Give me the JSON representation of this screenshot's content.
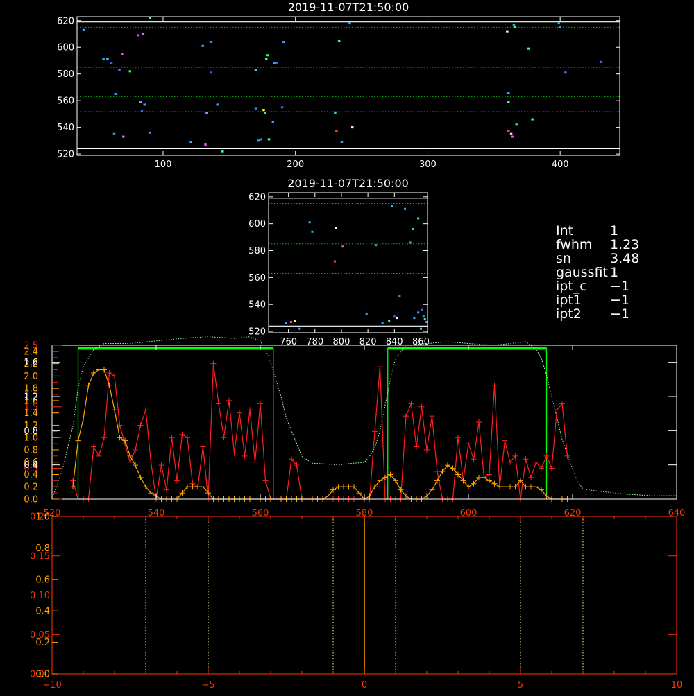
{
  "colors": {
    "background": "#000000",
    "frame": "#ffffff",
    "profile": "#ff2020",
    "fit": "#ffa500",
    "window_fill": "#00ff00",
    "ref_dotted": "#00c000",
    "red_dotted": "#c00000",
    "bottom_axis": "#ff3300",
    "bottom_marker": "#ffa500",
    "bottom_dotted": "#ffff80"
  },
  "params": {
    "rows": [
      {
        "key": "Int",
        "value": "1"
      },
      {
        "key": "fwhm",
        "value": "1.23"
      },
      {
        "key": "sn",
        "value": "3.48"
      },
      {
        "key": "gaussfit",
        "value": "1"
      },
      {
        "key": "ipt_c",
        "value": "−1"
      },
      {
        "key": "ipt1",
        "value": "−1"
      },
      {
        "key": "ipt2",
        "value": "−1"
      }
    ]
  },
  "chart_data": [
    {
      "id": "top",
      "type": "scatter",
      "title": "2019-11-07T21:50:00",
      "xlabel": "",
      "ylabel": "",
      "xlim": [
        35,
        445
      ],
      "ylim": [
        519,
        623
      ],
      "xticks": [
        100,
        200,
        300,
        400
      ],
      "yticks": [
        520,
        540,
        560,
        580,
        600,
        620
      ],
      "grid": false,
      "ref_lines_white": [
        619,
        524
      ],
      "ref_lines_green": [
        615,
        585,
        563
      ],
      "ref_lines_red": [
        552
      ],
      "points": [
        {
          "x": 40,
          "y": 613,
          "c": "#33aaff"
        },
        {
          "x": 55,
          "y": 591,
          "c": "#33aaff"
        },
        {
          "x": 58,
          "y": 591,
          "c": "#33ccff"
        },
        {
          "x": 61,
          "y": 588,
          "c": "#3366ff"
        },
        {
          "x": 63,
          "y": 535,
          "c": "#33aaff"
        },
        {
          "x": 64,
          "y": 565,
          "c": "#3399ff"
        },
        {
          "x": 67,
          "y": 583,
          "c": "#aa44ff"
        },
        {
          "x": 69,
          "y": 595,
          "c": "#ff44ff"
        },
        {
          "x": 70,
          "y": 533,
          "c": "#aa88ff"
        },
        {
          "x": 75,
          "y": 582,
          "c": "#33ff66"
        },
        {
          "x": 81,
          "y": 609,
          "c": "#ff44ff"
        },
        {
          "x": 83,
          "y": 559,
          "c": "#aa88ff"
        },
        {
          "x": 84,
          "y": 552,
          "c": "#3366ff"
        },
        {
          "x": 85,
          "y": 610,
          "c": "#aa88ff"
        },
        {
          "x": 86,
          "y": 557,
          "c": "#33aaff"
        },
        {
          "x": 90,
          "y": 536,
          "c": "#3399ff"
        },
        {
          "x": 90,
          "y": 622,
          "c": "#33ffaa"
        },
        {
          "x": 121,
          "y": 529,
          "c": "#33aaff"
        },
        {
          "x": 130,
          "y": 601,
          "c": "#33aaff"
        },
        {
          "x": 132,
          "y": 527,
          "c": "#ff44ff"
        },
        {
          "x": 133,
          "y": 551,
          "c": "#aa88ff"
        },
        {
          "x": 136,
          "y": 604,
          "c": "#3399ff"
        },
        {
          "x": 136,
          "y": 581,
          "c": "#3366ff"
        },
        {
          "x": 141,
          "y": 557,
          "c": "#33aaff"
        },
        {
          "x": 145,
          "y": 522,
          "c": "#33ffaa"
        },
        {
          "x": 170,
          "y": 583,
          "c": "#33ccff"
        },
        {
          "x": 170,
          "y": 554,
          "c": "#3366ff"
        },
        {
          "x": 172,
          "y": 530,
          "c": "#33aaff"
        },
        {
          "x": 174,
          "y": 531,
          "c": "#3399ff"
        },
        {
          "x": 176,
          "y": 553,
          "c": "#ffff33"
        },
        {
          "x": 177,
          "y": 551,
          "c": "#33ff66"
        },
        {
          "x": 178,
          "y": 591,
          "c": "#33ffaa"
        },
        {
          "x": 179,
          "y": 594,
          "c": "#33ff66"
        },
        {
          "x": 180,
          "y": 531,
          "c": "#33ffaa"
        },
        {
          "x": 183,
          "y": 544,
          "c": "#3399ff"
        },
        {
          "x": 184,
          "y": 588,
          "c": "#33aaff"
        },
        {
          "x": 186,
          "y": 588,
          "c": "#3366ff"
        },
        {
          "x": 190,
          "y": 555,
          "c": "#3366ff"
        },
        {
          "x": 191,
          "y": 604,
          "c": "#3399ff"
        },
        {
          "x": 230,
          "y": 551,
          "c": "#33ccff"
        },
        {
          "x": 231,
          "y": 537,
          "c": "#ff4444"
        },
        {
          "x": 233,
          "y": 605,
          "c": "#33ff66"
        },
        {
          "x": 235,
          "y": 529,
          "c": "#33aaff"
        },
        {
          "x": 241,
          "y": 618,
          "c": "#33aaff"
        },
        {
          "x": 243,
          "y": 540,
          "c": "#ffffff"
        },
        {
          "x": 360,
          "y": 612,
          "c": "#ffffff"
        },
        {
          "x": 361,
          "y": 559,
          "c": "#33ffaa"
        },
        {
          "x": 361,
          "y": 537,
          "c": "#ff4444"
        },
        {
          "x": 361,
          "y": 566,
          "c": "#33aaff"
        },
        {
          "x": 363,
          "y": 535,
          "c": "#ffffff"
        },
        {
          "x": 364,
          "y": 533,
          "c": "#ff44ff"
        },
        {
          "x": 365,
          "y": 617,
          "c": "#33aaff"
        },
        {
          "x": 366,
          "y": 615,
          "c": "#33ff66"
        },
        {
          "x": 367,
          "y": 542,
          "c": "#33ff66"
        },
        {
          "x": 376,
          "y": 599,
          "c": "#33ffaa"
        },
        {
          "x": 379,
          "y": 546,
          "c": "#33ffaa"
        },
        {
          "x": 399,
          "y": 618,
          "c": "#3399ff"
        },
        {
          "x": 400,
          "y": 615,
          "c": "#33aaff"
        },
        {
          "x": 404,
          "y": 581,
          "c": "#aa44ff"
        },
        {
          "x": 431,
          "y": 589,
          "c": "#aa44ff"
        }
      ]
    },
    {
      "id": "mid",
      "type": "scatter",
      "title": "2019-11-07T21:50:00",
      "xlabel": "",
      "ylabel": "",
      "xlim": [
        745,
        865
      ],
      "ylim": [
        519,
        623
      ],
      "xticks": [
        760,
        780,
        800,
        820,
        840,
        860
      ],
      "yticks": [
        520,
        540,
        560,
        580,
        600,
        620
      ],
      "grid": false,
      "ref_lines_white": [
        619,
        524
      ],
      "ref_lines_green": [
        615,
        585,
        563
      ],
      "points": [
        {
          "x": 758,
          "y": 526,
          "c": "#33aaff"
        },
        {
          "x": 762,
          "y": 527,
          "c": "#ff44ff"
        },
        {
          "x": 765,
          "y": 528,
          "c": "#ffff33"
        },
        {
          "x": 768,
          "y": 522,
          "c": "#3399ff"
        },
        {
          "x": 776,
          "y": 601,
          "c": "#33aaff"
        },
        {
          "x": 778,
          "y": 594,
          "c": "#33aaff"
        },
        {
          "x": 795,
          "y": 572,
          "c": "#ff4444"
        },
        {
          "x": 796,
          "y": 597,
          "c": "#ffffff"
        },
        {
          "x": 801,
          "y": 583,
          "c": "#ff44ff"
        },
        {
          "x": 819,
          "y": 533,
          "c": "#33aaff"
        },
        {
          "x": 826,
          "y": 584,
          "c": "#33aaff"
        },
        {
          "x": 831,
          "y": 526,
          "c": "#33aaff"
        },
        {
          "x": 836,
          "y": 528,
          "c": "#33ff66"
        },
        {
          "x": 838,
          "y": 613,
          "c": "#33aaff"
        },
        {
          "x": 840,
          "y": 531,
          "c": "#3366ff"
        },
        {
          "x": 842,
          "y": 530,
          "c": "#ffffff"
        },
        {
          "x": 844,
          "y": 546,
          "c": "#3399ff"
        },
        {
          "x": 848,
          "y": 611,
          "c": "#33aaff"
        },
        {
          "x": 852,
          "y": 586,
          "c": "#3399ff"
        },
        {
          "x": 854,
          "y": 596,
          "c": "#33ccff"
        },
        {
          "x": 855,
          "y": 530,
          "c": "#33aaff"
        },
        {
          "x": 858,
          "y": 604,
          "c": "#33ff66"
        },
        {
          "x": 858,
          "y": 534,
          "c": "#33aaff"
        },
        {
          "x": 860,
          "y": 522,
          "c": "#33ccff"
        },
        {
          "x": 861,
          "y": 536,
          "c": "#3366ff"
        },
        {
          "x": 862,
          "y": 531,
          "c": "#33aaff"
        },
        {
          "x": 863,
          "y": 529,
          "c": "#33ffaa"
        },
        {
          "x": 864,
          "y": 527,
          "c": "#3399ff"
        }
      ]
    },
    {
      "id": "profile",
      "type": "line",
      "title": "",
      "xlabel": "",
      "ylabel": "",
      "xlim": [
        520,
        640
      ],
      "xticks": [
        520,
        540,
        560,
        580,
        600,
        620,
        640
      ],
      "ylim_red": [
        0,
        2.5
      ],
      "yticks_red": [
        0.0,
        0.5,
        1.0,
        1.5,
        2.0,
        2.5
      ],
      "yticks_red_labels": [
        "0.0",
        "0.5",
        "1.0",
        "1.5",
        "2.0",
        "2.5"
      ],
      "ylim_orange": [
        0,
        2.5
      ],
      "yticks_orange": [
        0.0,
        0.2,
        0.4,
        0.6,
        0.8,
        1.0,
        1.2,
        1.4,
        1.6,
        1.8,
        2.0,
        2.2,
        2.4
      ],
      "yticks_orange_labels": [
        "0.0",
        "0.2",
        "0.4",
        "0.6",
        "0.8",
        "1.0",
        "1.2",
        "1.4",
        "1.6",
        "1.8",
        "2.0",
        "2.2",
        "2.4"
      ],
      "ylim_white": [
        0,
        1.8
      ],
      "yticks_white": [
        0.4,
        0.8,
        1.2,
        1.6
      ],
      "yticks_white_labels": [
        "0.4",
        "0.8",
        "1.2",
        "1.6"
      ],
      "windows": [
        [
          525,
          562.5
        ],
        [
          584.5,
          615
        ]
      ],
      "window_top": 2.45,
      "red_series": {
        "name": "",
        "x": [
          524,
          525,
          526,
          527,
          528,
          529,
          530,
          531,
          532,
          533,
          534,
          535,
          536,
          537,
          538,
          539,
          540,
          541,
          542,
          543,
          544,
          545,
          546,
          547,
          548,
          549,
          550,
          551,
          552,
          553,
          554,
          555,
          556,
          557,
          558,
          559,
          560,
          561,
          562,
          563,
          564,
          565,
          566,
          567,
          568,
          569,
          570,
          571,
          572,
          573,
          574,
          575,
          576,
          577,
          578,
          579,
          580,
          581,
          582,
          583,
          584,
          585,
          586,
          587,
          588,
          589,
          590,
          591,
          592,
          593,
          594,
          595,
          596,
          597,
          598,
          599,
          600,
          601,
          602,
          603,
          604,
          605,
          606,
          607,
          608,
          609,
          610,
          611,
          612,
          613,
          614,
          615,
          616,
          617,
          618,
          619
        ],
        "y": [
          0.3,
          0.0,
          0.0,
          0.0,
          0.85,
          0.7,
          1.0,
          2.05,
          2.0,
          1.2,
          0.9,
          0.6,
          0.8,
          1.2,
          1.45,
          0.6,
          0.0,
          0.55,
          0.15,
          1.0,
          0.3,
          1.05,
          1.0,
          0.25,
          0.2,
          0.85,
          0.0,
          2.2,
          1.55,
          1.0,
          1.6,
          0.75,
          1.4,
          0.7,
          1.45,
          0.6,
          1.55,
          0.3,
          0.0,
          0.0,
          0.0,
          0.0,
          0.65,
          0.55,
          0.0,
          0.0,
          0.0,
          0.0,
          0.0,
          0.0,
          0.0,
          0.0,
          0.0,
          0.0,
          0.0,
          0.0,
          0.0,
          0.0,
          1.1,
          2.15,
          0.0,
          0.0,
          0.0,
          0.0,
          1.35,
          1.55,
          0.85,
          1.5,
          0.8,
          1.35,
          0.45,
          0.0,
          0.0,
          0.0,
          1.0,
          0.3,
          0.9,
          0.65,
          1.25,
          0.35,
          0.4,
          1.85,
          0.2,
          0.95,
          0.6,
          0.7,
          0.0,
          0.65,
          0.35,
          0.6,
          0.5,
          0.7,
          0.5,
          1.45,
          1.55,
          0.7
        ]
      },
      "fit_series": {
        "name": "",
        "x": [
          524,
          525,
          526,
          527,
          528,
          529,
          530,
          531,
          532,
          533,
          534,
          535,
          536,
          537,
          538,
          539,
          540,
          541,
          542,
          543,
          544,
          545,
          546,
          547,
          548,
          549,
          550,
          551,
          552,
          553,
          554,
          555,
          556,
          557,
          558,
          559,
          560,
          561,
          562,
          563,
          564,
          565,
          566,
          567,
          568,
          569,
          570,
          571,
          572,
          573,
          574,
          575,
          576,
          577,
          578,
          579,
          580,
          581,
          582,
          583,
          584,
          585,
          586,
          587,
          588,
          589,
          590,
          591,
          592,
          593,
          594,
          595,
          596,
          597,
          598,
          599,
          600,
          601,
          602,
          603,
          604,
          605,
          606,
          607,
          608,
          609,
          610,
          611,
          612,
          613,
          614,
          615,
          616,
          617,
          618,
          619
        ],
        "y": [
          0.2,
          0.95,
          1.3,
          1.85,
          2.05,
          2.1,
          2.1,
          1.85,
          1.45,
          1.0,
          0.95,
          0.7,
          0.55,
          0.35,
          0.2,
          0.1,
          0.05,
          0.0,
          0.0,
          0.0,
          0.0,
          0.1,
          0.2,
          0.2,
          0.2,
          0.2,
          0.1,
          0.0,
          0.0,
          0.0,
          0.0,
          0.0,
          0.0,
          0.0,
          0.0,
          0.0,
          0.0,
          0.0,
          0.0,
          0.0,
          0.0,
          0.0,
          0.0,
          0.0,
          0.0,
          0.0,
          0.0,
          0.0,
          0.0,
          0.05,
          0.15,
          0.2,
          0.2,
          0.2,
          0.2,
          0.1,
          0.0,
          0.05,
          0.2,
          0.3,
          0.35,
          0.4,
          0.3,
          0.15,
          0.05,
          0.0,
          0.0,
          0.0,
          0.05,
          0.15,
          0.3,
          0.45,
          0.55,
          0.5,
          0.4,
          0.3,
          0.2,
          0.25,
          0.35,
          0.35,
          0.3,
          0.25,
          0.2,
          0.2,
          0.2,
          0.2,
          0.3,
          0.2,
          0.2,
          0.2,
          0.15,
          0.05,
          0.0,
          0.0,
          0.0,
          0.0
        ]
      },
      "reference_series": {
        "name": "",
        "x": [
          520,
          522,
          524,
          525,
          526,
          528,
          530,
          532,
          535,
          540,
          545,
          550,
          555,
          558,
          560,
          561,
          562,
          563,
          564,
          565,
          566,
          568,
          570,
          575,
          578,
          580,
          581,
          582,
          583,
          584,
          585,
          586,
          588,
          592,
          596,
          600,
          605,
          608,
          611,
          612,
          613,
          614,
          615,
          616,
          617,
          618,
          620,
          621,
          622,
          624,
          630,
          635,
          640
        ],
        "y": [
          0.0,
          0.35,
          0.85,
          1.3,
          1.55,
          1.75,
          1.82,
          1.82,
          1.82,
          1.85,
          1.88,
          1.9,
          1.88,
          1.9,
          1.85,
          1.75,
          1.6,
          1.4,
          1.2,
          0.95,
          0.8,
          0.5,
          0.42,
          0.4,
          0.42,
          0.43,
          0.5,
          0.6,
          0.8,
          1.1,
          1.4,
          1.65,
          1.8,
          1.82,
          1.84,
          1.82,
          1.8,
          1.82,
          1.84,
          1.8,
          1.75,
          1.65,
          1.45,
          1.2,
          0.95,
          0.7,
          0.35,
          0.2,
          0.12,
          0.1,
          0.06,
          0.04,
          0.04
        ]
      }
    },
    {
      "id": "bottom",
      "type": "line",
      "title": "",
      "xlabel": "",
      "ylabel": "",
      "xlim": [
        -10,
        10
      ],
      "xticks": [
        -10,
        -5,
        0,
        5,
        10
      ],
      "xtick_labels": [
        "−10",
        "−5",
        "0",
        "5",
        "10"
      ],
      "ylim_red": [
        0,
        0.2
      ],
      "yticks_red": [
        0.0,
        0.05,
        0.1,
        0.15,
        0.2
      ],
      "yticks_red_labels": [
        "0.00",
        "0.05",
        "0.10",
        "0.15",
        "0.20"
      ],
      "ylim_orange": [
        0,
        1.0
      ],
      "yticks_orange": [
        0.0,
        0.2,
        0.4,
        0.6,
        0.8,
        1.0
      ],
      "yticks_orange_labels": [
        "0.0",
        "0.2",
        "0.4",
        "0.6",
        "0.8",
        "1.0"
      ],
      "vlines_dotted": [
        -7,
        -5,
        -1,
        1,
        5,
        7
      ],
      "vline_solid": 0
    }
  ]
}
